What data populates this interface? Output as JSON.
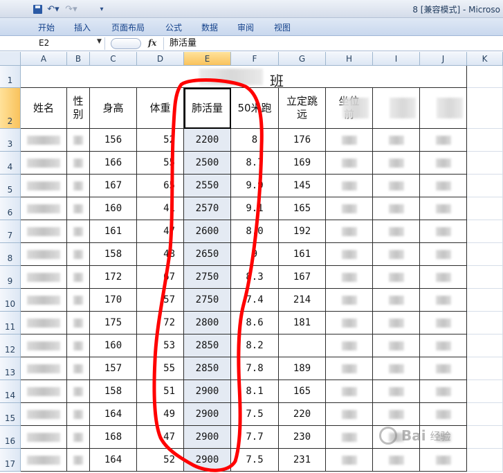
{
  "window": {
    "title": "8 [兼容模式] - Microso"
  },
  "ribbon": {
    "tabs": [
      "开始",
      "插入",
      "页面布局",
      "公式",
      "数据",
      "审阅",
      "视图"
    ]
  },
  "formula_bar": {
    "name_box": "E2",
    "fx_label": "fx",
    "value": "肺活量"
  },
  "sheet": {
    "columns": [
      "A",
      "B",
      "C",
      "D",
      "E",
      "F",
      "G",
      "H",
      "I",
      "J",
      "K"
    ],
    "selected_column": "E",
    "row_numbers": [
      "1",
      "2",
      "3",
      "4",
      "5",
      "6",
      "7",
      "8",
      "9",
      "10",
      "11",
      "12",
      "13",
      "14",
      "15",
      "16",
      "17"
    ],
    "title_cell": "班",
    "headers": {
      "name": "姓名",
      "gender": "性\n别",
      "height": "身高",
      "weight": "体重",
      "lung": "肺活量",
      "run50": "50米跑",
      "jump": "立定跳\n远",
      "sit_reach": "坐位\n前",
      "run_long": "",
      "other": ""
    },
    "rows": [
      {
        "height": "156",
        "weight": "52",
        "lung": "2200",
        "run50": "8",
        "jump": "176"
      },
      {
        "height": "166",
        "weight": "55",
        "lung": "2500",
        "run50": "8.7",
        "jump": "169"
      },
      {
        "height": "167",
        "weight": "65",
        "lung": "2550",
        "run50": "9.9",
        "jump": "145"
      },
      {
        "height": "160",
        "weight": "41",
        "lung": "2570",
        "run50": "9.1",
        "jump": "165"
      },
      {
        "height": "161",
        "weight": "47",
        "lung": "2600",
        "run50": "8.0",
        "jump": "192"
      },
      {
        "height": "158",
        "weight": "48",
        "lung": "2650",
        "run50": "9",
        "jump": "161"
      },
      {
        "height": "172",
        "weight": "67",
        "lung": "2750",
        "run50": "8.3",
        "jump": "167"
      },
      {
        "height": "170",
        "weight": "57",
        "lung": "2750",
        "run50": "7.4",
        "jump": "214"
      },
      {
        "height": "175",
        "weight": "72",
        "lung": "2800",
        "run50": "8.6",
        "jump": "181"
      },
      {
        "height": "160",
        "weight": "53",
        "lung": "2850",
        "run50": "8.2",
        "jump": ""
      },
      {
        "height": "157",
        "weight": "55",
        "lung": "2850",
        "run50": "7.8",
        "jump": "189"
      },
      {
        "height": "158",
        "weight": "51",
        "lung": "2900",
        "run50": "8.1",
        "jump": "165"
      },
      {
        "height": "164",
        "weight": "49",
        "lung": "2900",
        "run50": "7.5",
        "jump": "220"
      },
      {
        "height": "168",
        "weight": "47",
        "lung": "2900",
        "run50": "7.7",
        "jump": "230"
      },
      {
        "height": "164",
        "weight": "52",
        "lung": "2900",
        "run50": "7.5",
        "jump": "231"
      }
    ]
  },
  "watermark": {
    "text": "Bai",
    "sub": "经验"
  },
  "colors": {
    "selection_header": "#f9c25c",
    "annotation": "#ff0000",
    "column_highlight": "#e4eaf3"
  }
}
